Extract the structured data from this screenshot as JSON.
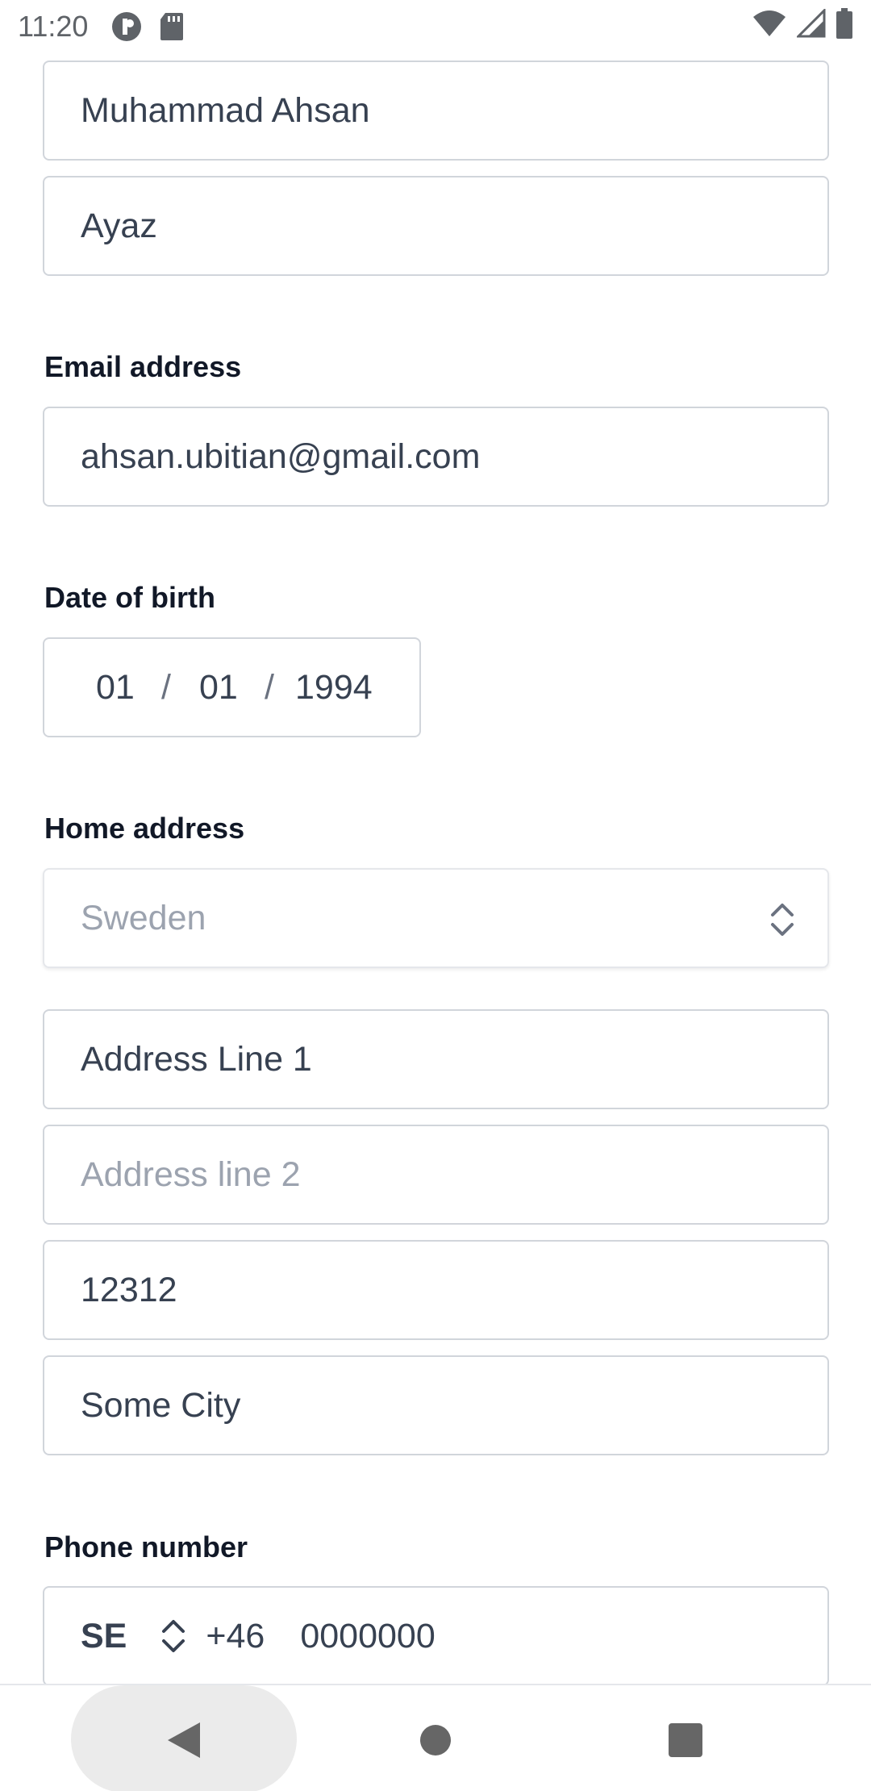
{
  "status_bar": {
    "time": "11:20",
    "icons": [
      "app-notification-icon",
      "sd-card-icon",
      "wifi-icon",
      "cell-signal-icon",
      "battery-icon"
    ]
  },
  "form": {
    "first_name": {
      "value": "Muhammad Ahsan"
    },
    "last_name": {
      "value": "Ayaz"
    },
    "email": {
      "label": "Email address",
      "value": "ahsan.ubitian@gmail.com"
    },
    "dob": {
      "label": "Date of birth",
      "day": "01",
      "month": "01",
      "year": "1994",
      "separator": "/"
    },
    "home_address": {
      "label": "Home address",
      "country": "Sweden",
      "line1": "Address Line 1",
      "line2_placeholder": "Address line 2",
      "postal_code": "12312",
      "city": "Some City"
    },
    "phone": {
      "label": "Phone number",
      "country_code": "SE",
      "dial_code": "+46",
      "number": "0000000"
    }
  },
  "colors": {
    "text": "#374151",
    "label": "#111827",
    "placeholder": "#9ca3af",
    "border": "#d1d5db"
  }
}
